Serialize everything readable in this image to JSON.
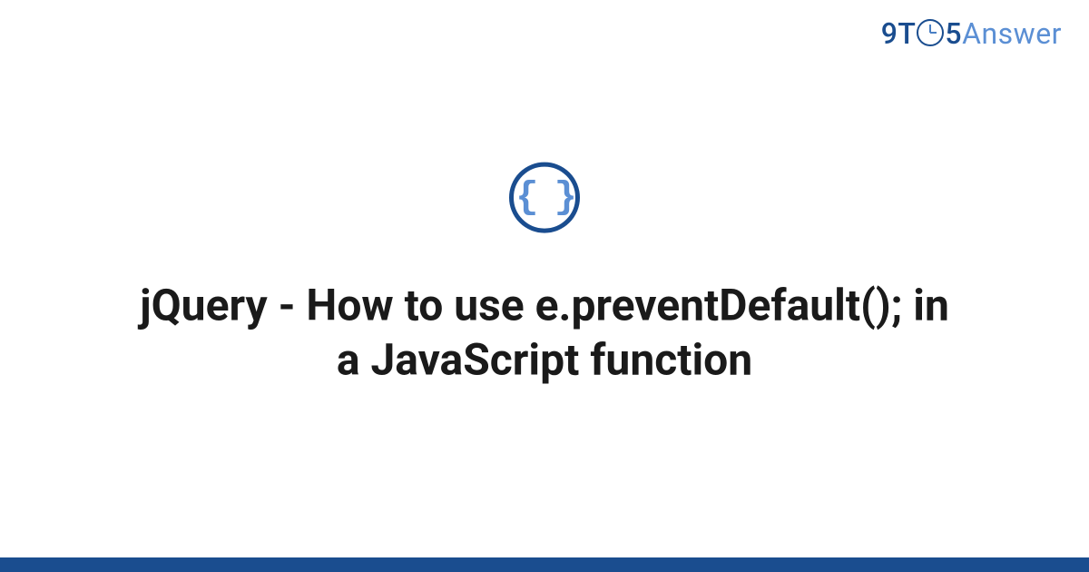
{
  "logo": {
    "prefix": "9T",
    "suffix": "5",
    "word": "Answer"
  },
  "icon": {
    "glyph": "{ }",
    "name": "code-braces"
  },
  "title": "jQuery - How to use e.preventDefault(); in a JavaScript function",
  "colors": {
    "primary": "#1a4d8f",
    "accent": "#5b8fd4"
  }
}
